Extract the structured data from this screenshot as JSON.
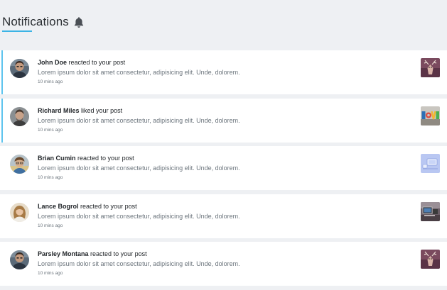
{
  "header": {
    "title": "Notifications",
    "icon": "bell-icon",
    "accent_color": "#3cb4e5"
  },
  "notifications": [
    {
      "name": "John Doe",
      "action": "reacted to your post",
      "message": "Lorem ipsum dolor sit amet consectetur, adipisicing elit. Unde, dolorem.",
      "time": "10 mins ago",
      "unread": true
    },
    {
      "name": "Richard Miles",
      "action": "liked your post",
      "message": "Lorem ipsum dolor sit amet consectetur, adipisicing elit. Unde, dolorem.",
      "time": "10 mins ago",
      "unread": true
    },
    {
      "name": "Brian Cumin",
      "action": "reacted to your post",
      "message": "Lorem ipsum dolor sit amet consectetur, adipisicing elit. Unde, dolorem.",
      "time": "10 mins ago",
      "unread": false
    },
    {
      "name": "Lance Bogrol",
      "action": "reacted to your post",
      "message": "Lorem ipsum dolor sit amet consectetur, adipisicing elit. Unde, dolorem.",
      "time": "10 mins ago",
      "unread": false
    },
    {
      "name": "Parsley Montana",
      "action": "reacted to your post",
      "message": "Lorem ipsum dolor sit amet consectetur, adipisicing elit. Unde, dolorem.",
      "time": "10 mins ago",
      "unread": false
    }
  ]
}
